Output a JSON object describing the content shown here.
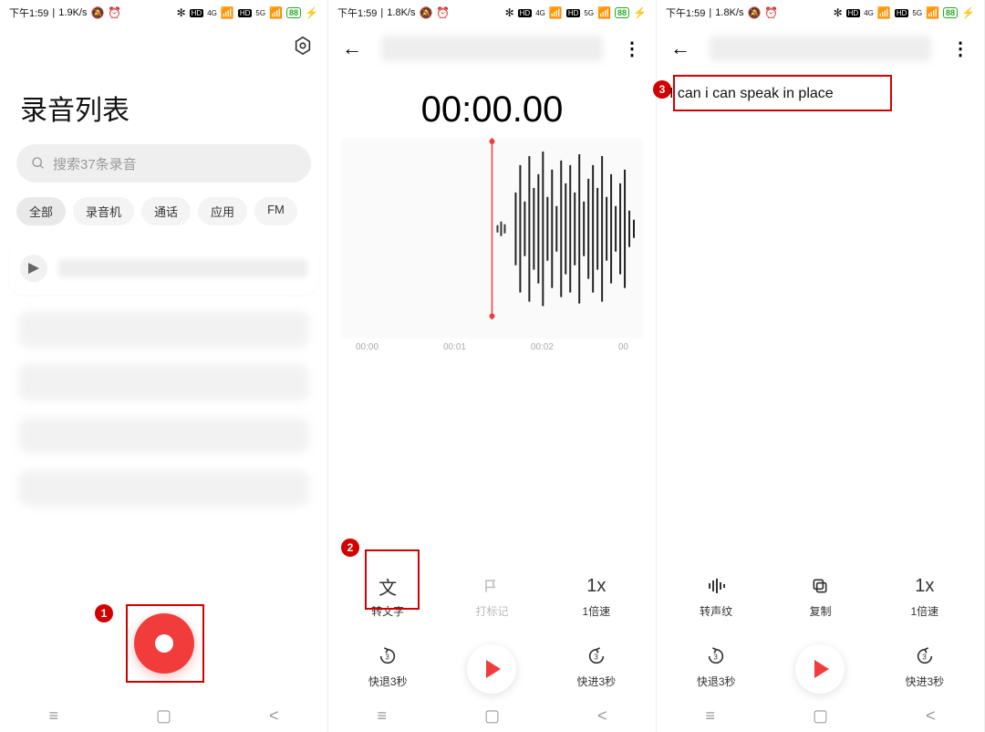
{
  "status": {
    "time": "下午1:59",
    "net_a": "1.9K/s",
    "net_b": "1.8K/s",
    "hd": "HD",
    "gen_a": "4G",
    "gen_b": "5G",
    "battery": "88"
  },
  "s1": {
    "title": "录音列表",
    "search_placeholder": "搜索37条录音",
    "chips": [
      "全部",
      "录音机",
      "通话",
      "应用",
      "FM"
    ]
  },
  "s2": {
    "timer": "00:00.00",
    "axis": [
      "00:00",
      "00:01",
      "00:02",
      "00"
    ],
    "ctrl_text": "文",
    "ctrl_to_text": "转文字",
    "ctrl_mark": "打标记",
    "ctrl_speed_sym": "1x",
    "ctrl_speed": "1倍速",
    "ctrl_rewind": "快退3秒",
    "ctrl_forward": "快进3秒"
  },
  "s3": {
    "transcript": "I can i can speak in place",
    "ctrl_voiceprint": "转声纹",
    "ctrl_copy": "复制",
    "ctrl_speed_sym": "1x",
    "ctrl_speed": "1倍速",
    "ctrl_rewind": "快退3秒",
    "ctrl_forward": "快进3秒"
  },
  "callouts": {
    "1": "1",
    "2": "2",
    "3": "3"
  }
}
